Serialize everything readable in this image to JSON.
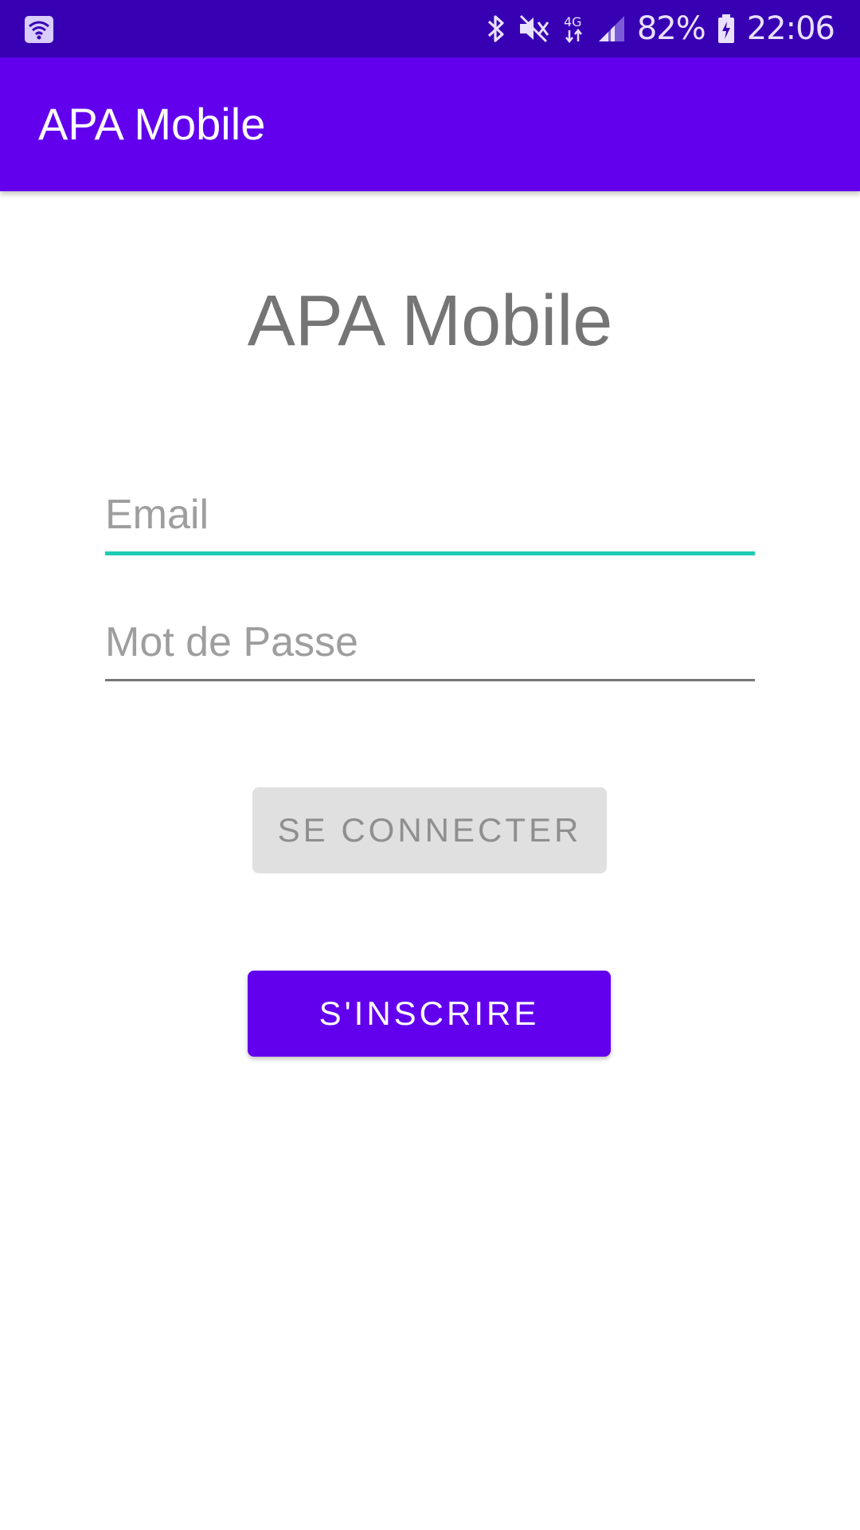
{
  "status_bar": {
    "battery": "82%",
    "time": "22:06",
    "icons": [
      "wifi-notification-icon",
      "bluetooth-icon",
      "mute-icon",
      "4g-icon",
      "signal-icon",
      "battery-icon"
    ]
  },
  "app_bar": {
    "title": "APA Mobile"
  },
  "main": {
    "title": "APA Mobile",
    "email": {
      "placeholder": "Email",
      "value": ""
    },
    "password": {
      "placeholder": "Mot de Passe",
      "value": ""
    },
    "login_button": "SE CONNECTER",
    "signup_button": "S'INSCRIRE"
  },
  "colors": {
    "status_bar": "#3700b3",
    "primary": "#6200ee",
    "accent": "#1ecbb4"
  }
}
